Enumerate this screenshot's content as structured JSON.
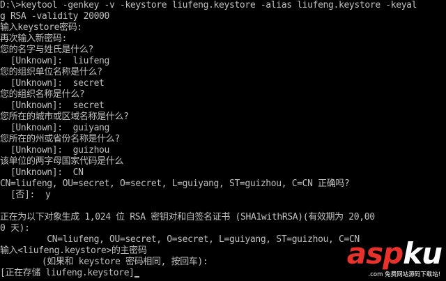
{
  "console": {
    "lines": [
      "D:\\>keytool -genkey -v -keystore liufeng.keystore -alias liufeng.keystore -keyal",
      "g RSA -validity 20000",
      "输入keystore密码:",
      "再次输入新密码:",
      "您的名字与姓氏是什么?",
      "  [Unknown]:  liufeng",
      "您的组织单位名称是什么?",
      "  [Unknown]:  secret",
      "您的组织名称是什么?",
      "  [Unknown]:  secret",
      "您所在的城市或区域名称是什么?",
      "  [Unknown]:  guiyang",
      "您所在的州或省份名称是什么?",
      "  [Unknown]:  guizhou",
      "该单位的两字母国家代码是什么",
      "  [Unknown]:  CN",
      "CN=liufeng, OU=secret, O=secret, L=guiyang, ST=guizhou, C=CN 正确吗?",
      "  [否]:  y",
      "",
      "正在为以下对象生成 1,024 位 RSA 密钥对和自签名证书 (SHA1withRSA)(有效期为 20,00",
      "0 天):",
      "         CN=liufeng, OU=secret, O=secret, L=guiyang, ST=guizhou, C=CN",
      "输入<liufeng.keystore>的主密码",
      "        (如果和 keystore 密码相同, 按回车):",
      "[正在存储 liufeng.keystore]"
    ]
  },
  "watermark": {
    "brand_part1": "asp",
    "brand_part2": "ku",
    "brand_suffix": ".com",
    "tagline": "免费网站源码下载站!"
  },
  "colors": {
    "background": "#000000",
    "text": "#c0c0c0",
    "brand_red": "#e8312a",
    "brand_white": "#ffffff"
  }
}
